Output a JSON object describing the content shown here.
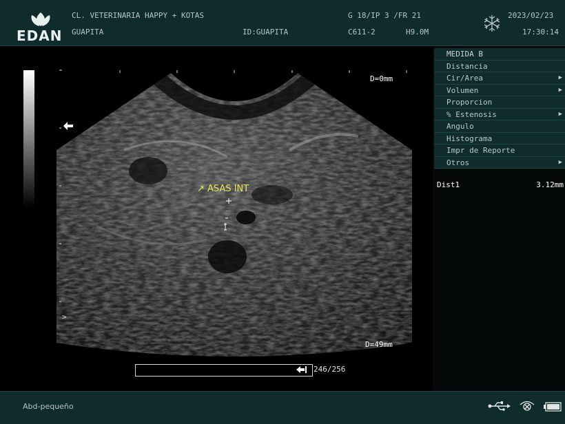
{
  "header": {
    "brand": "EDAN",
    "clinic": "CL. VETERINARIA HAPPY + KOTAS",
    "patient": "GUAPITA",
    "patient_id": "ID:GUAPITA",
    "params_1": "G 18/IP 3 /FR 21",
    "probe": "C611-2",
    "frequency": "H9.0M",
    "date": "2023/02/23",
    "time": "17:30:14",
    "freeze_icon": "snowflake-icon"
  },
  "image": {
    "depth_top": "D=0mm",
    "depth_bottom": "D=49mm",
    "annotation": "↗ ASAS INT",
    "focus_marker": ">"
  },
  "cine": {
    "frame_count": "246/256",
    "progress": 0.96
  },
  "menu": {
    "title": "MEDIDA B",
    "items": [
      {
        "label": "Distancia",
        "submenu": false
      },
      {
        "label": "Cir/Area",
        "submenu": true
      },
      {
        "label": "Volumen",
        "submenu": true
      },
      {
        "label": "Proporcion",
        "submenu": false
      },
      {
        "label": "% Estenosis",
        "submenu": true
      },
      {
        "label": "Angulo",
        "submenu": false
      },
      {
        "label": "Histograma",
        "submenu": false
      },
      {
        "label": "Impr de Reporte",
        "submenu": false
      },
      {
        "label": "Otros",
        "submenu": true
      }
    ]
  },
  "measurement": {
    "label": "Dist1",
    "value": "3.12mm"
  },
  "footer": {
    "preset": "Abd-pequeño",
    "icons": [
      "usb-icon",
      "printer-icon",
      "battery-icon"
    ]
  },
  "colors": {
    "panel": "#0f2b2b",
    "annotation": "#e8e45a",
    "text": "#b8c4c4"
  }
}
